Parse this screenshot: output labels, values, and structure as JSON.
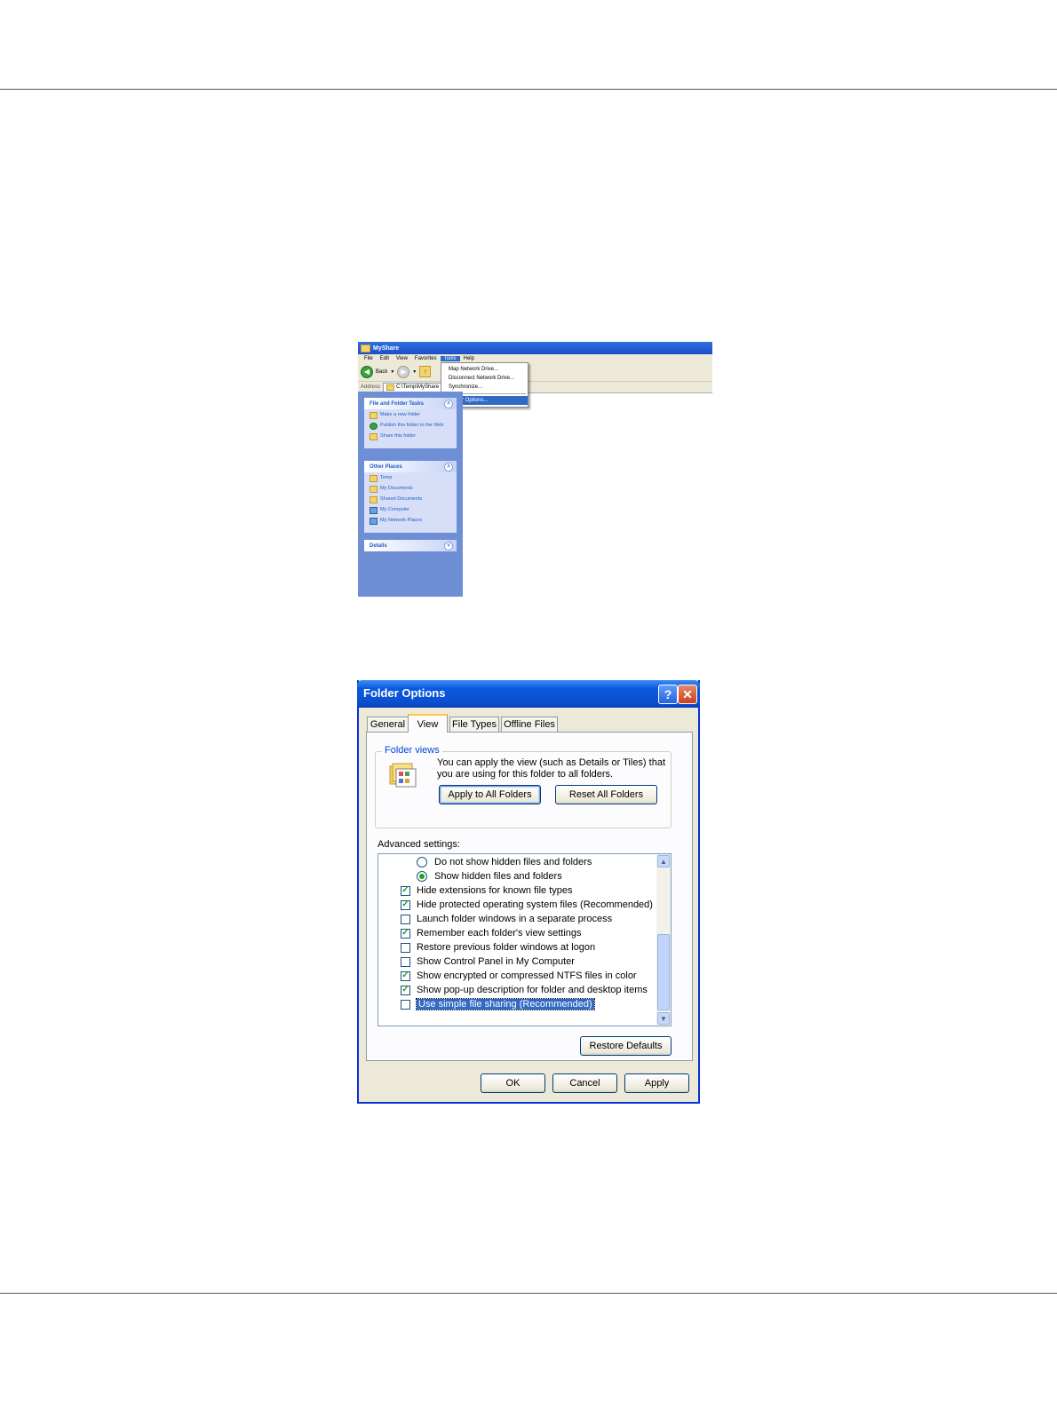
{
  "explorer": {
    "window_title": "MyShare",
    "menubar": [
      "File",
      "Edit",
      "View",
      "Favorites",
      "Tools",
      "Help"
    ],
    "toolbar": {
      "back_label": "Back"
    },
    "address": {
      "label": "Address",
      "value": "C:\\Temp\\MyShare"
    },
    "tools_menu": [
      "Map Network Drive...",
      "Disconnect Network Drive...",
      "Synchronize...",
      "Folder Options..."
    ],
    "file_folder_tasks": {
      "title": "File and Folder Tasks",
      "items": [
        "Make a new folder",
        "Publish this folder to the Web",
        "Share this folder"
      ]
    },
    "other_places": {
      "title": "Other Places",
      "items": [
        "Temp",
        "My Documents",
        "Shared Documents",
        "My Computer",
        "My Network Places"
      ]
    },
    "details": {
      "title": "Details"
    }
  },
  "dialog": {
    "title": "Folder Options",
    "tabs": [
      "General",
      "View",
      "File Types",
      "Offline Files"
    ],
    "folder_views": {
      "title": "Folder views",
      "description": "You can apply the view (such as Details or Tiles) that you are using for this folder to all folders.",
      "apply_all": "Apply to All Folders",
      "reset_all": "Reset All Folders"
    },
    "advanced_label": "Advanced settings:",
    "settings": [
      {
        "type": "radio",
        "label": "Do not show hidden files and folders",
        "checked": false
      },
      {
        "type": "radio",
        "label": "Show hidden files and folders",
        "checked": true
      },
      {
        "type": "checkbox",
        "label": "Hide extensions for known file types",
        "checked": true
      },
      {
        "type": "checkbox",
        "label": "Hide protected operating system files (Recommended)",
        "checked": true
      },
      {
        "type": "checkbox",
        "label": "Launch folder windows in a separate process",
        "checked": false
      },
      {
        "type": "checkbox",
        "label": "Remember each folder's view settings",
        "checked": true
      },
      {
        "type": "checkbox",
        "label": "Restore previous folder windows at logon",
        "checked": false
      },
      {
        "type": "checkbox",
        "label": "Show Control Panel in My Computer",
        "checked": false
      },
      {
        "type": "checkbox",
        "label": "Show encrypted or compressed NTFS files in color",
        "checked": true
      },
      {
        "type": "checkbox",
        "label": "Show pop-up description for folder and desktop items",
        "checked": true
      },
      {
        "type": "checkbox",
        "label": "Use simple file sharing (Recommended)",
        "checked": false,
        "selected": true
      }
    ],
    "restore_defaults": "Restore Defaults",
    "ok": "OK",
    "cancel": "Cancel",
    "apply": "Apply"
  }
}
